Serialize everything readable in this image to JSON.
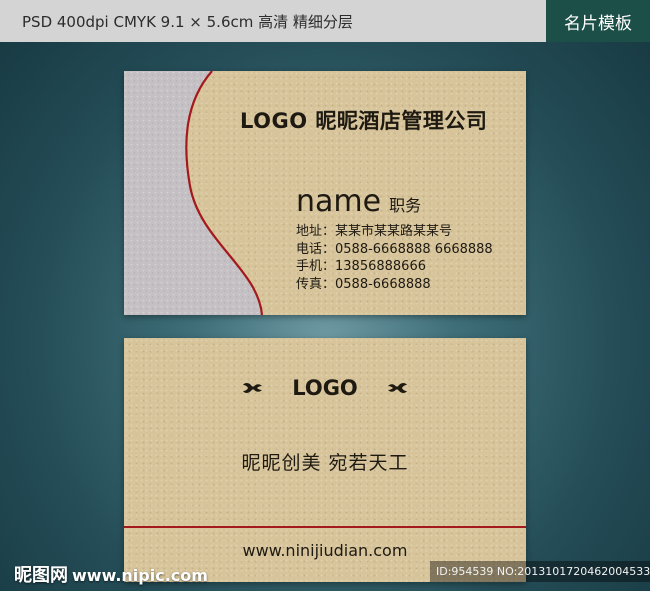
{
  "header": {
    "spec": "PSD 400dpi CMYK  9.1 × 5.6cm  高清 精细分层",
    "tag": "名片模板"
  },
  "front": {
    "company": "LOGO 昵昵酒店管理公司",
    "name": "name",
    "title": "职务",
    "info": [
      "地址：某某市某某路某某号",
      "电话：0588-6668888 6668888",
      "手机：13856888666",
      "传真：0588-6668888"
    ]
  },
  "back": {
    "logo": "LOGO",
    "slogan": "昵昵创美  宛若天工",
    "website": "www.ninijiudian.com"
  },
  "watermark": {
    "site_name": "昵图网",
    "site_url": "www.nipic.com",
    "id_text": "ID:954539 NO:20131017204620045333"
  },
  "colors": {
    "card": "#d7c49a",
    "card_gray_panel": "#c4c0c4",
    "accent_red": "#a4191c",
    "tag_bg": "#1c4f47"
  }
}
